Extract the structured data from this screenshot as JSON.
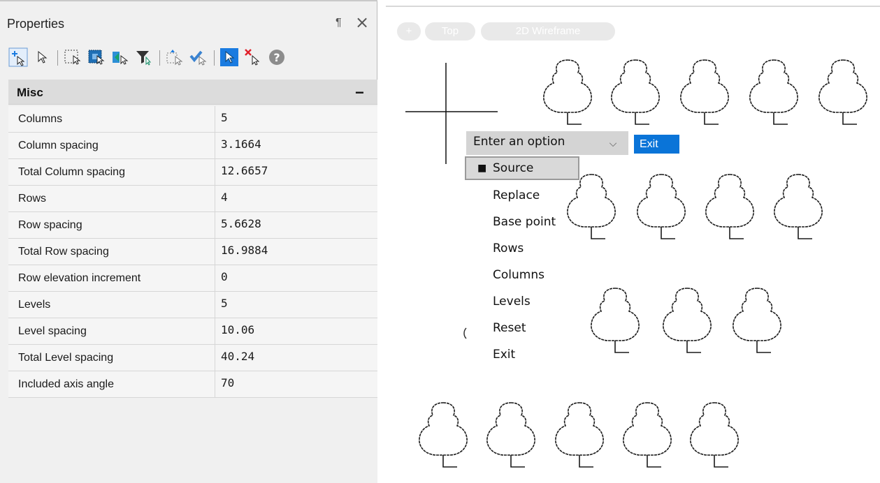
{
  "palette": {
    "title": "Properties",
    "pin_glyph": "¶",
    "close_glyph": "×",
    "toolbar_icons": [
      "add-selection-icon",
      "select-objects-icon",
      "window-select-icon",
      "crossing-select-icon",
      "invert-selection-icon",
      "filter-icon",
      "select-similar-icon",
      "quick-select-icon",
      "pickadd-icon",
      "remove-selection-icon",
      "help-icon"
    ],
    "section": {
      "label": "Misc",
      "collapse_glyph": "−"
    },
    "rows": [
      {
        "name": "Columns",
        "value": "5"
      },
      {
        "name": "Column spacing",
        "value": "3.1664"
      },
      {
        "name": "Total Column spacing",
        "value": "12.6657"
      },
      {
        "name": "Rows",
        "value": "4"
      },
      {
        "name": "Row spacing",
        "value": "5.6628"
      },
      {
        "name": "Total Row spacing",
        "value": "16.9884"
      },
      {
        "name": "Row elevation increment",
        "value": "0"
      },
      {
        "name": "Levels",
        "value": "5"
      },
      {
        "name": "Level spacing",
        "value": "10.06"
      },
      {
        "name": "Total Level spacing",
        "value": "40.24"
      },
      {
        "name": "Included axis angle",
        "value": "70"
      }
    ]
  },
  "viewport": {
    "controls": {
      "menu": "+",
      "view": "Top",
      "visual_style": "2D Wireframe"
    }
  },
  "dynamic_input": {
    "prompt": "Enter an option",
    "exit_label": "Exit",
    "options": [
      "Source",
      "Replace",
      "Base point",
      "Rows",
      "Columns",
      "Levels",
      "Reset",
      "Exit"
    ],
    "selected_index": 0
  },
  "colors": {
    "accent": "#0a74d8",
    "panel": "#f0f0f0",
    "header": "#dcdcdc"
  }
}
